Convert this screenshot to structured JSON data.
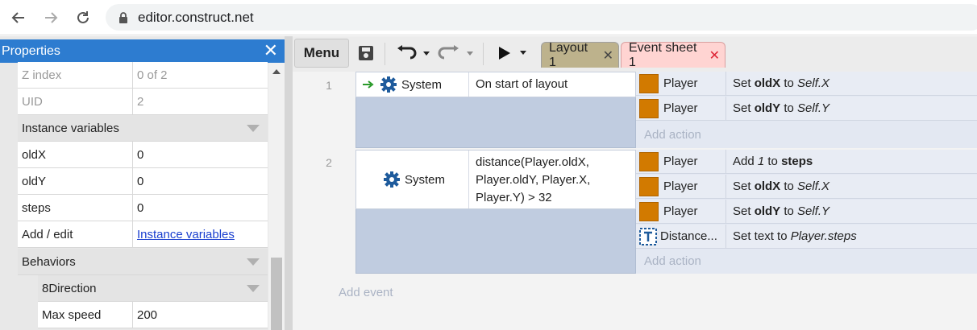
{
  "browser": {
    "url": "editor.construct.net"
  },
  "properties": {
    "title": "Properties",
    "close_glyph": "✕",
    "rows_top": [
      {
        "name": "Z index",
        "value": "0 of 2"
      },
      {
        "name": "UID",
        "value": "2"
      }
    ],
    "instance_vars_label": "Instance variables",
    "instance_vars": [
      {
        "name": "oldX",
        "value": "0"
      },
      {
        "name": "oldY",
        "value": "0"
      },
      {
        "name": "steps",
        "value": "0"
      }
    ],
    "add_edit": {
      "name": "Add / edit",
      "value": "Instance variables"
    },
    "behaviors_label": "Behaviors",
    "behavior_name": "8Direction",
    "max_speed": {
      "name": "Max speed",
      "value": "200"
    }
  },
  "toolbar": {
    "menu_label": "Menu",
    "tabs": [
      {
        "label": "Layout 1",
        "close": "✕"
      },
      {
        "label": "Event sheet 1",
        "close": "✕"
      }
    ]
  },
  "events": [
    {
      "number": "1",
      "object": "System",
      "condition": "On start of layout",
      "actions": [
        {
          "object": "Player",
          "pre": "Set ",
          "bold": "oldX",
          "mid": " to ",
          "italic": "Self.X"
        },
        {
          "object": "Player",
          "pre": "Set ",
          "bold": "oldY",
          "mid": " to ",
          "italic": "Self.Y"
        }
      ],
      "add_action": "Add action"
    },
    {
      "number": "2",
      "object": "System",
      "condition_lines": [
        "distance(Player.oldX,",
        "Player.oldY, Player.X,",
        "Player.Y) > 32"
      ],
      "actions": [
        {
          "object": "Player",
          "pre": "Add ",
          "italic1": "1",
          "mid": " to ",
          "bold": "steps"
        },
        {
          "object": "Player",
          "pre": "Set ",
          "bold": "oldX",
          "mid": " to ",
          "italic": "Self.X"
        },
        {
          "object": "Player",
          "pre": "Set ",
          "bold": "oldY",
          "mid": " to ",
          "italic": "Self.Y"
        },
        {
          "object": "Distance...",
          "pre": "Set text to ",
          "italic": "Player.steps"
        }
      ],
      "add_action": "Add action"
    }
  ],
  "add_event": "Add event",
  "colors": {
    "panel_header": "#2d7cd0",
    "player_icon": "#d27a00",
    "event_left": "#c0cce0",
    "gear": "#1e5b9c",
    "arrow": "#2a9a2a"
  }
}
